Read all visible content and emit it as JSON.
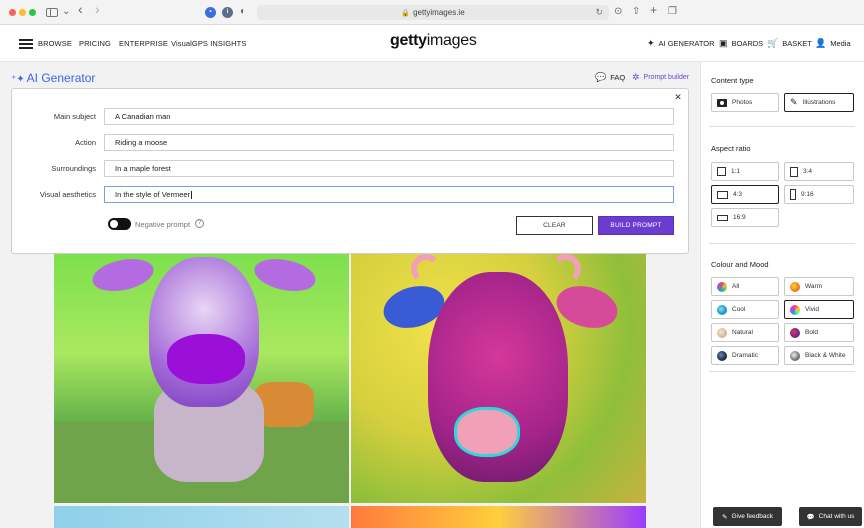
{
  "browser": {
    "url": "gettyimages.ie",
    "nav_back": "‹",
    "nav_forward": "›"
  },
  "header": {
    "nav": [
      "BROWSE",
      "PRICING",
      "ENTERPRISE",
      "VisualGPS INSIGHTS"
    ],
    "logo_bold": "getty",
    "logo_light": "images",
    "right": {
      "ai_generator": "AI GENERATOR",
      "boards": "BOARDS",
      "basket": "BASKET",
      "media": "Media"
    }
  },
  "main": {
    "title": "AI Generator",
    "faq": "FAQ",
    "prompt_builder": "Prompt builder"
  },
  "dialog": {
    "fields": [
      {
        "label": "Main subject",
        "value": "A Canadian man"
      },
      {
        "label": "Action",
        "value": "Riding a moose"
      },
      {
        "label": "Surroundings",
        "value": "In a maple forest"
      },
      {
        "label": "Visual aesthetics",
        "value": "In the style of Vermeer"
      }
    ],
    "negative_prompt": "Negative prompt",
    "negative_prompt_on": false,
    "clear": "CLEAR",
    "build": "BUILD PROMPT"
  },
  "panel": {
    "content_type": {
      "title": "Content type",
      "options": [
        "Photos",
        "Illustrations"
      ],
      "selected": "Illustrations"
    },
    "aspect_ratio": {
      "title": "Aspect ratio",
      "options": [
        "1:1",
        "3:4",
        "4:3",
        "9:16",
        "16:9"
      ],
      "selected": "4:3"
    },
    "colour_mood": {
      "title": "Colour and Mood",
      "options": [
        "All",
        "Warm",
        "Cool",
        "Vivid",
        "Natural",
        "Bold",
        "Dramatic",
        "Black & White"
      ],
      "selected": "Vivid"
    }
  },
  "footer": {
    "feedback": "Give feedback",
    "chat": "Chat with us"
  },
  "colors": {
    "accent_purple": "#6a3cd0",
    "ai_blue": "#3a67e0"
  }
}
